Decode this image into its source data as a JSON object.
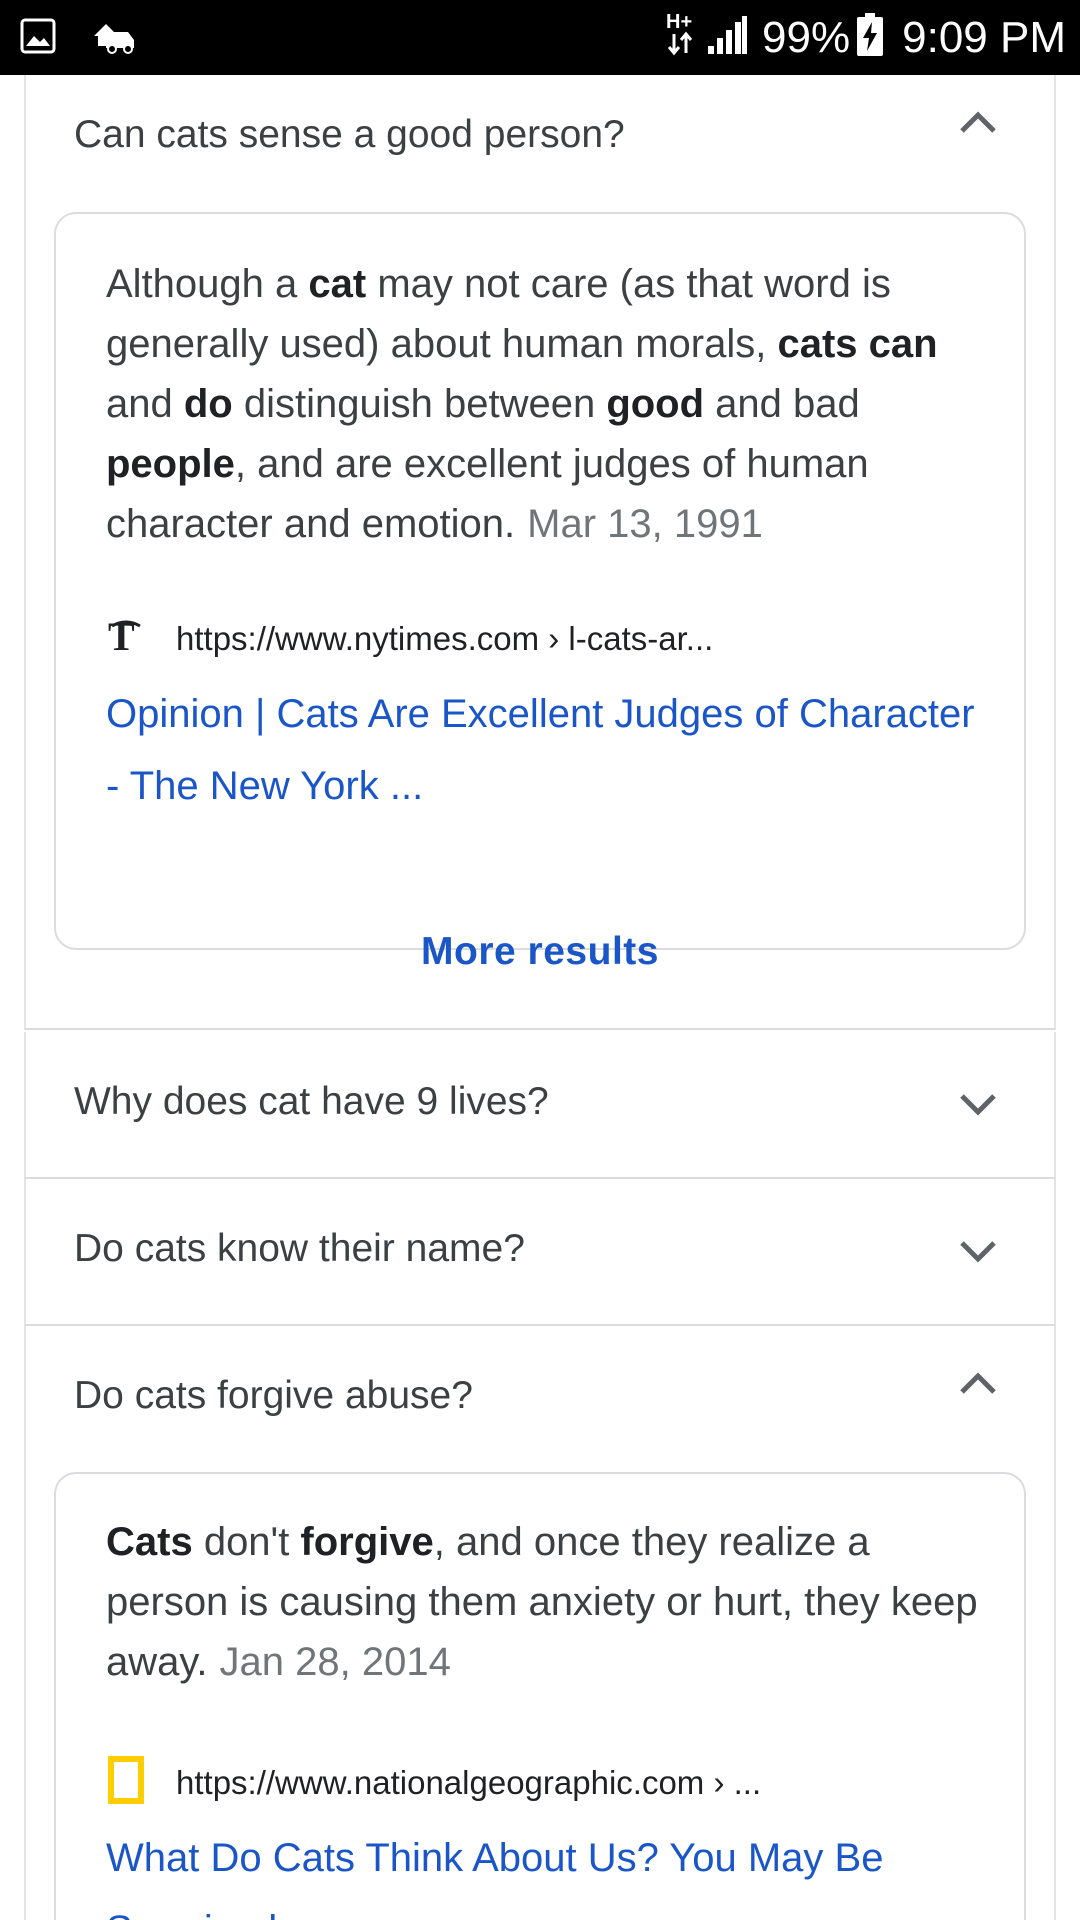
{
  "status_bar": {
    "network": "H+",
    "battery": "99%",
    "time": "9:09 PM",
    "icons": [
      "gallery-icon",
      "car-notification-icon",
      "network-hplus-icon",
      "signal-icon",
      "battery-charging-icon"
    ]
  },
  "faq": [
    {
      "question": "Can cats sense a good person?",
      "expanded": true,
      "answer_parts": [
        {
          "t": "Although a ",
          "b": false
        },
        {
          "t": "cat",
          "b": true
        },
        {
          "t": " may not care (as that word is generally used) about human morals, ",
          "b": false
        },
        {
          "t": "cats can",
          "b": true
        },
        {
          "t": " and ",
          "b": false
        },
        {
          "t": "do",
          "b": true
        },
        {
          "t": " distinguish between ",
          "b": false
        },
        {
          "t": "good",
          "b": true
        },
        {
          "t": " and bad ",
          "b": false
        },
        {
          "t": "people",
          "b": true
        },
        {
          "t": ", and are excellent judges of human character and emotion.",
          "b": false
        }
      ],
      "date": "Mar 13, 1991",
      "source_icon": "nytimes-logo-icon",
      "source_url": "https://www.nytimes.com › l-cats-ar...",
      "result_title": "Opinion | Cats Are Excellent Judges of Character - The New York ..."
    },
    {
      "question": "Why does cat have 9 lives?",
      "expanded": false
    },
    {
      "question": "Do cats know their name?",
      "expanded": false
    },
    {
      "question": "Do cats forgive abuse?",
      "expanded": true,
      "answer_parts": [
        {
          "t": "Cats",
          "b": true
        },
        {
          "t": " don't ",
          "b": false
        },
        {
          "t": "forgive",
          "b": true
        },
        {
          "t": ", and once they realize a person is causing them anxiety or hurt, they keep away.",
          "b": false
        }
      ],
      "date": "Jan 28, 2014",
      "source_icon": "natgeo-logo-icon",
      "source_url": "https://www.nationalgeographic.com › ...",
      "result_title": "What Do Cats Think About Us? You May Be Surprised"
    }
  ],
  "more_results": "More results",
  "colors": {
    "link": "#1a56c8",
    "text": "#3c4043",
    "date": "#70757a",
    "border": "#dadce0",
    "natgeo_yellow": "#ffce00"
  }
}
